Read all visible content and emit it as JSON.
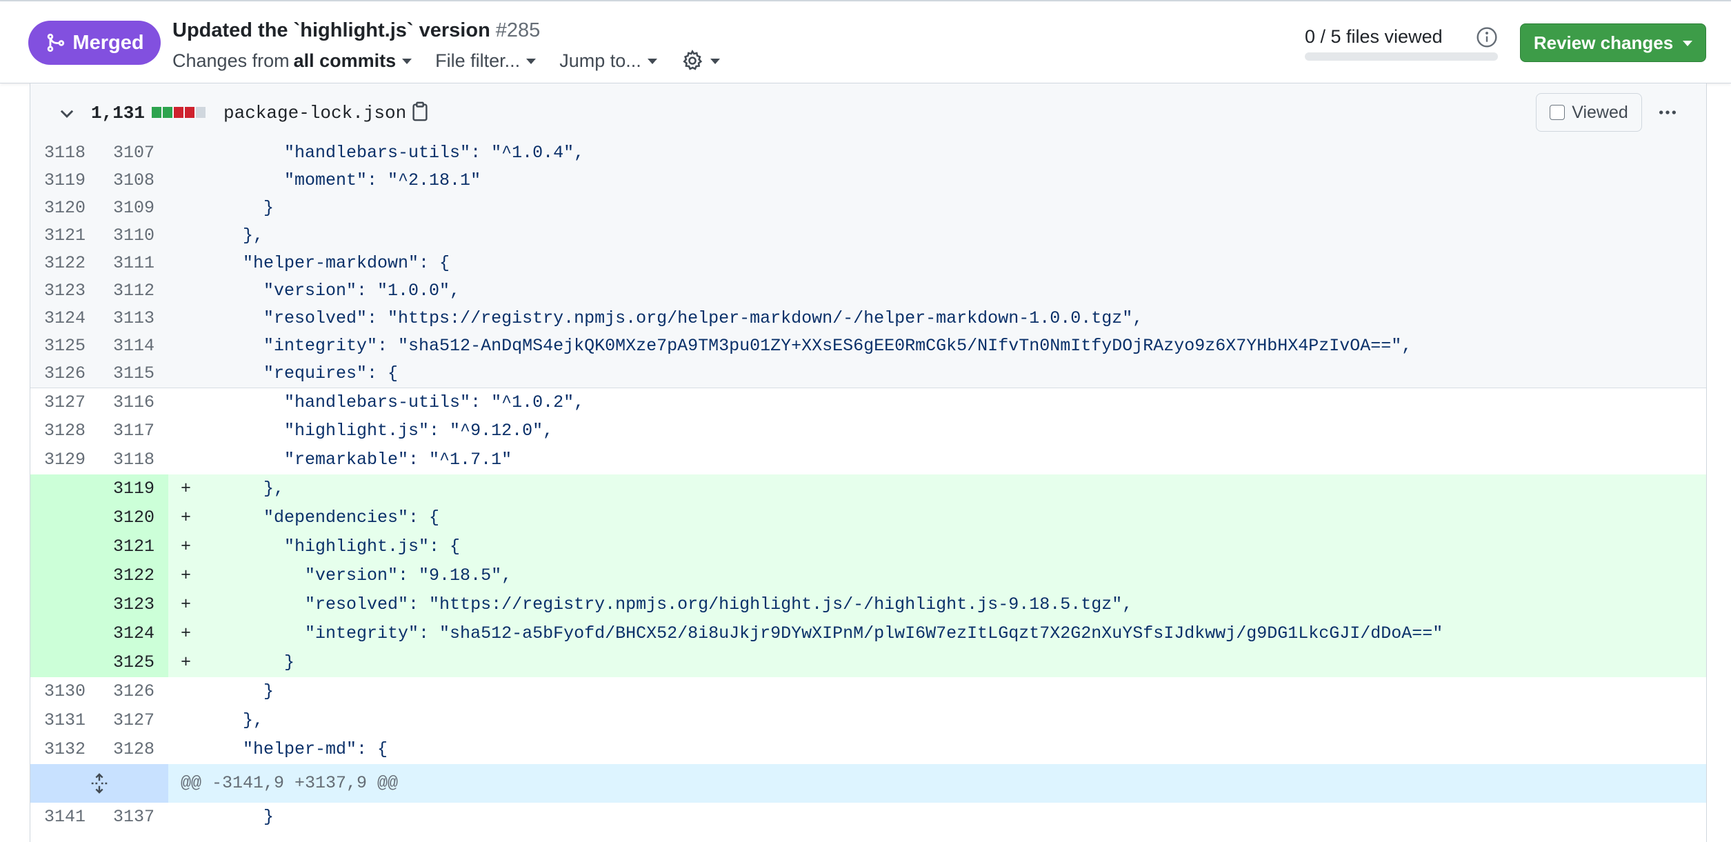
{
  "header": {
    "status_label": "Merged",
    "title": "Updated the `highlight.js` version",
    "number": "#285",
    "changes_prefix": "Changes from",
    "changes_value": "all commits",
    "file_filter": "File filter...",
    "jump_to": "Jump to...",
    "files_viewed": "0 / 5 files viewed",
    "files_viewed_fraction": 0,
    "review_button": "Review changes"
  },
  "file": {
    "change_count": "1,131",
    "diffstat": [
      "add",
      "add",
      "del",
      "del",
      "neutral"
    ],
    "name": "package-lock.json",
    "viewed_label": "Viewed"
  },
  "colors": {
    "merged": "#8250df",
    "review_green": "#3d9c48",
    "addition_bg": "#e6ffec",
    "addition_gutter": "#ccffd8",
    "hunk_bg": "#ddf4ff"
  },
  "diff": {
    "lines": [
      {
        "type": "ctx-exp",
        "old": "3118",
        "new": "3107",
        "sign": "",
        "text": "        \"handlebars-utils\": \"^1.0.4\","
      },
      {
        "type": "ctx-exp",
        "old": "3119",
        "new": "3108",
        "sign": "",
        "text": "        \"moment\": \"^2.18.1\""
      },
      {
        "type": "ctx-exp",
        "old": "3120",
        "new": "3109",
        "sign": "",
        "text": "      }"
      },
      {
        "type": "ctx-exp",
        "old": "3121",
        "new": "3110",
        "sign": "",
        "text": "    },"
      },
      {
        "type": "ctx-exp",
        "old": "3122",
        "new": "3111",
        "sign": "",
        "text": "    \"helper-markdown\": {"
      },
      {
        "type": "ctx-exp",
        "old": "3123",
        "new": "3112",
        "sign": "",
        "text": "      \"version\": \"1.0.0\","
      },
      {
        "type": "ctx-exp",
        "old": "3124",
        "new": "3113",
        "sign": "",
        "text": "      \"resolved\": \"https://registry.npmjs.org/helper-markdown/-/helper-markdown-1.0.0.tgz\","
      },
      {
        "type": "ctx-exp",
        "old": "3125",
        "new": "3114",
        "sign": "",
        "text": "      \"integrity\": \"sha512-AnDqMS4ejkQK0MXze7pA9TM3pu01ZY+XXsES6gEE0RmCGk5/NIfvTn0NmItfyDOjRAzyo9z6X7YHbHX4PzIvOA==\","
      },
      {
        "type": "ctx-exp",
        "old": "3126",
        "new": "3115",
        "sign": "",
        "text": "      \"requires\": {"
      },
      {
        "type": "ctx",
        "old": "3127",
        "new": "3116",
        "sign": "",
        "text": "        \"handlebars-utils\": \"^1.0.2\","
      },
      {
        "type": "ctx",
        "old": "3128",
        "new": "3117",
        "sign": "",
        "text": "        \"highlight.js\": \"^9.12.0\","
      },
      {
        "type": "ctx",
        "old": "3129",
        "new": "3118",
        "sign": "",
        "text": "        \"remarkable\": \"^1.7.1\""
      },
      {
        "type": "add",
        "old": "",
        "new": "3119",
        "sign": "+",
        "text": "      },"
      },
      {
        "type": "add",
        "old": "",
        "new": "3120",
        "sign": "+",
        "text": "      \"dependencies\": {"
      },
      {
        "type": "add",
        "old": "",
        "new": "3121",
        "sign": "+",
        "text": "        \"highlight.js\": {"
      },
      {
        "type": "add",
        "old": "",
        "new": "3122",
        "sign": "+",
        "text": "          \"version\": \"9.18.5\","
      },
      {
        "type": "add",
        "old": "",
        "new": "3123",
        "sign": "+",
        "text": "          \"resolved\": \"https://registry.npmjs.org/highlight.js/-/highlight.js-9.18.5.tgz\","
      },
      {
        "type": "add",
        "old": "",
        "new": "3124",
        "sign": "+",
        "text": "          \"integrity\": \"sha512-a5bFyofd/BHCX52/8i8uJkjr9DYwXIPnM/plwI6W7ezItLGqzt7X2G2nXuYSfsIJdkwwj/g9DG1LkcGJI/dDoA==\""
      },
      {
        "type": "add",
        "old": "",
        "new": "3125",
        "sign": "+",
        "text": "        }"
      },
      {
        "type": "ctx",
        "old": "3130",
        "new": "3126",
        "sign": "",
        "text": "      }"
      },
      {
        "type": "ctx",
        "old": "3131",
        "new": "3127",
        "sign": "",
        "text": "    },"
      },
      {
        "type": "ctx",
        "old": "3132",
        "new": "3128",
        "sign": "",
        "text": "    \"helper-md\": {"
      },
      {
        "type": "hunk",
        "old": "",
        "new": "",
        "sign": "",
        "text": "@@ -3141,9 +3137,9 @@"
      },
      {
        "type": "ctx",
        "old": "3141",
        "new": "3137",
        "sign": "",
        "text": "      }"
      }
    ]
  }
}
